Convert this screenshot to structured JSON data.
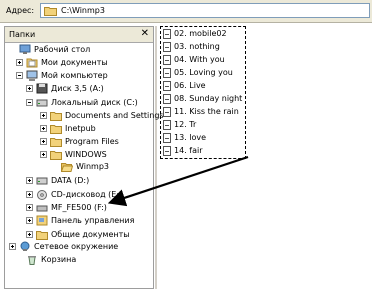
{
  "address": {
    "label": "Адрес:",
    "path": "C:\\Winmp3"
  },
  "folders_pane": {
    "title": "Папки",
    "close_symbol": "✕"
  },
  "tree": [
    {
      "label": "Рабочий стол",
      "icon": "desktop-icon",
      "expander": "none"
    },
    {
      "label": "Мои документы",
      "icon": "documents-icon",
      "expander": "plus"
    },
    {
      "label": "Мой компьютер",
      "icon": "computer-icon",
      "expander": "minus"
    },
    {
      "label": "Диск 3,5 (A:)",
      "icon": "floppy-icon",
      "expander": "plus"
    },
    {
      "label": "Локальный диск (C:)",
      "icon": "hard-drive-icon",
      "expander": "minus"
    },
    {
      "label": "Documents and Settings",
      "icon": "folder-icon",
      "expander": "plus"
    },
    {
      "label": "Inetpub",
      "icon": "folder-icon",
      "expander": "plus"
    },
    {
      "label": "Program Files",
      "icon": "folder-icon",
      "expander": "plus"
    },
    {
      "label": "WINDOWS",
      "icon": "folder-icon",
      "expander": "plus"
    },
    {
      "label": "Winmp3",
      "icon": "folder-open-icon",
      "expander": "none"
    },
    {
      "label": "DATA (D:)",
      "icon": "hard-drive-icon",
      "expander": "plus"
    },
    {
      "label": "CD-дисковод (E:)",
      "icon": "cd-drive-icon",
      "expander": "plus"
    },
    {
      "label": "MF_FE500 (F:)",
      "icon": "removable-drive-icon",
      "expander": "plus"
    },
    {
      "label": "Панель управления",
      "icon": "control-panel-icon",
      "expander": "plus"
    },
    {
      "label": "Общие документы",
      "icon": "folder-icon",
      "expander": "plus"
    },
    {
      "label": "Сетевое окружение",
      "icon": "network-icon",
      "expander": "plus"
    },
    {
      "label": "Корзина",
      "icon": "recycle-bin-icon",
      "expander": "none"
    }
  ],
  "files": [
    {
      "label": "02. mobile02",
      "icon": "audio-file-icon"
    },
    {
      "label": "03. nothing",
      "icon": "audio-file-icon"
    },
    {
      "label": "04. With you",
      "icon": "audio-file-icon"
    },
    {
      "label": "05. Loving you",
      "icon": "audio-file-icon"
    },
    {
      "label": "06. Live",
      "icon": "audio-file-icon"
    },
    {
      "label": "08. Sunday night",
      "icon": "audio-file-icon"
    },
    {
      "label": "11. Kiss the rain",
      "icon": "audio-file-icon"
    },
    {
      "label": "12. Tr",
      "icon": "audio-file-icon"
    },
    {
      "label": "13. love",
      "icon": "audio-file-icon"
    },
    {
      "label": "14. fair",
      "icon": "audio-file-icon"
    }
  ],
  "colors": {
    "chrome": "#ece9d8",
    "folder": "#f2d27a",
    "folder_border": "#b08a2a",
    "address_border": "#7f9db9"
  }
}
